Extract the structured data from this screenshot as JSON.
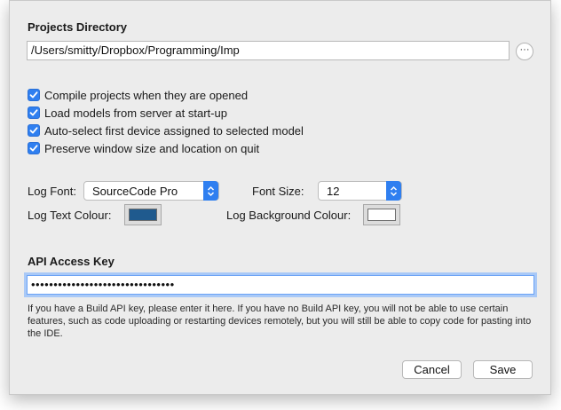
{
  "projects_directory": {
    "title": "Projects Directory",
    "path_value": "/Users/smitty/Dropbox/Programming/Imp",
    "browse_label": "···"
  },
  "options": [
    {
      "label": "Compile projects when they are opened",
      "checked": true
    },
    {
      "label": "Load models from server at start-up",
      "checked": true
    },
    {
      "label": "Auto-select first device assigned to selected model",
      "checked": true
    },
    {
      "label": "Preserve window size and location on quit",
      "checked": true
    }
  ],
  "log": {
    "font_label": "Log Font:",
    "font_value": "SourceCode Pro",
    "size_label": "Font Size:",
    "size_value": "12",
    "text_colour_label": "Log Text Colour:",
    "text_colour": "#1f5a8e",
    "bg_colour_label": "Log Background Colour:",
    "bg_colour": "#ffffff"
  },
  "api": {
    "title": "API Access Key",
    "masked_value": "••••••••••••••••••••••••••••••••",
    "help_text": "If you have a Build API key, please enter it here. If you have no Build API key, you will not be able to use certain features, such as code uploading or restarting devices remotely, but you will still be able to copy code for pasting into the IDE."
  },
  "buttons": {
    "cancel": "Cancel",
    "save": "Save"
  },
  "colors": {
    "accent": "#2f7ff0",
    "focus_ring": "#a9c9f7",
    "dialog_bg": "#ececec"
  }
}
